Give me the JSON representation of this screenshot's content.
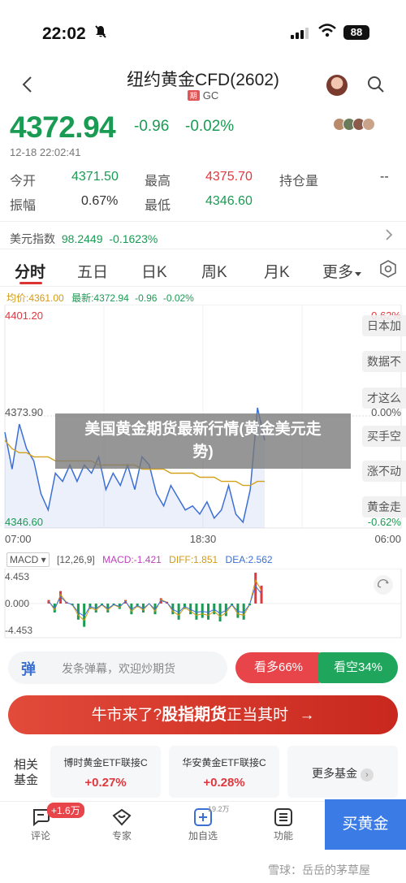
{
  "status": {
    "time": "22:02",
    "battery": "88"
  },
  "header": {
    "title": "纽约黄金CFD(2602)",
    "tag": "期",
    "code": "GC"
  },
  "quote": {
    "price": "4372.94",
    "change": "-0.96",
    "change_pct": "-0.02%",
    "datetime": "12-18 22:02:41",
    "open_label": "今开",
    "open": "4371.50",
    "high_label": "最高",
    "high": "4375.70",
    "oi_label": "持仓量",
    "oi": "--",
    "amp_label": "振幅",
    "amp": "0.67%",
    "low_label": "最低",
    "low": "4346.60"
  },
  "usd_index": {
    "label": "美元指数",
    "value": "98.2449",
    "pct": "-0.1623%"
  },
  "tabs": [
    "分时",
    "五日",
    "日K",
    "周K",
    "月K",
    "更多"
  ],
  "chart_legend": {
    "avg": "均价:4361.00",
    "latest": "最新:4372.94",
    "chg": "-0.96",
    "pct": "-0.02%"
  },
  "chart_data": {
    "type": "line",
    "x_ticks": [
      "07:00",
      "18:30",
      "06:00"
    ],
    "y_left": [
      "4401.20",
      "4373.90",
      "4346.60"
    ],
    "y_right": [
      "0.62%",
      "0.00%",
      "-0.62%"
    ],
    "ylim": [
      4346.6,
      4401.2
    ],
    "series": [
      {
        "name": "最新",
        "values": [
          4370,
          4361,
          4372,
          4366,
          4363,
          4355,
          4351,
          4360,
          4358,
          4362,
          4358,
          4362,
          4360,
          4364,
          4356,
          4360,
          4357,
          4362,
          4356,
          4364,
          4362,
          4355,
          4352,
          4357,
          4354,
          4351,
          4352,
          4350,
          4353,
          4349,
          4351,
          4357,
          4350,
          4348,
          4356,
          4376,
          4368
        ]
      },
      {
        "name": "均价",
        "values": [
          4368,
          4366,
          4365,
          4365,
          4364,
          4364,
          4364,
          4363,
          4363,
          4363,
          4363,
          4363,
          4363,
          4362,
          4362,
          4362,
          4362,
          4362,
          4362,
          4361,
          4361,
          4361,
          4361,
          4360,
          4360,
          4360,
          4360,
          4359,
          4359,
          4359,
          4358,
          4358,
          4358,
          4357,
          4357,
          4358,
          4358
        ]
      }
    ]
  },
  "side_labels": [
    "日本加",
    "数据不",
    "才这么",
    "买手空",
    "涨不动",
    "黄金走"
  ],
  "overlay": {
    "line1": "美国黄金期货最新行情(黄金美元走",
    "line2": "势)"
  },
  "macd": {
    "name": "MACD",
    "params": "[12,26,9]",
    "macd": "MACD:-1.421",
    "diff": "DIFF:1.851",
    "dea": "DEA:2.562",
    "top": "4.453",
    "mid": "0.000",
    "bottom": "-4.453"
  },
  "danmu": {
    "icon": "弹",
    "placeholder": "发条弹幕，欢迎炒期货"
  },
  "sentiment": {
    "bull": "看多66%",
    "bear": "看空34%"
  },
  "banner": {
    "a": "牛市来了?",
    "b": "股指期货",
    "c": "正当其时"
  },
  "funds": {
    "title": "相关基金",
    "items": [
      {
        "name": "博时黄金ETF联接C",
        "value": "+0.27%"
      },
      {
        "name": "华安黄金ETF联接C",
        "value": "+0.28%"
      }
    ],
    "more": "更多基金"
  },
  "nav": {
    "comment": "评论",
    "comment_badge": "+1.6万",
    "expert": "专家",
    "watch": "加自选",
    "watch_badge": "19.2万",
    "func": "功能",
    "buy": "买黄金"
  },
  "watermark": "雪球：岳岳的茅草屋"
}
